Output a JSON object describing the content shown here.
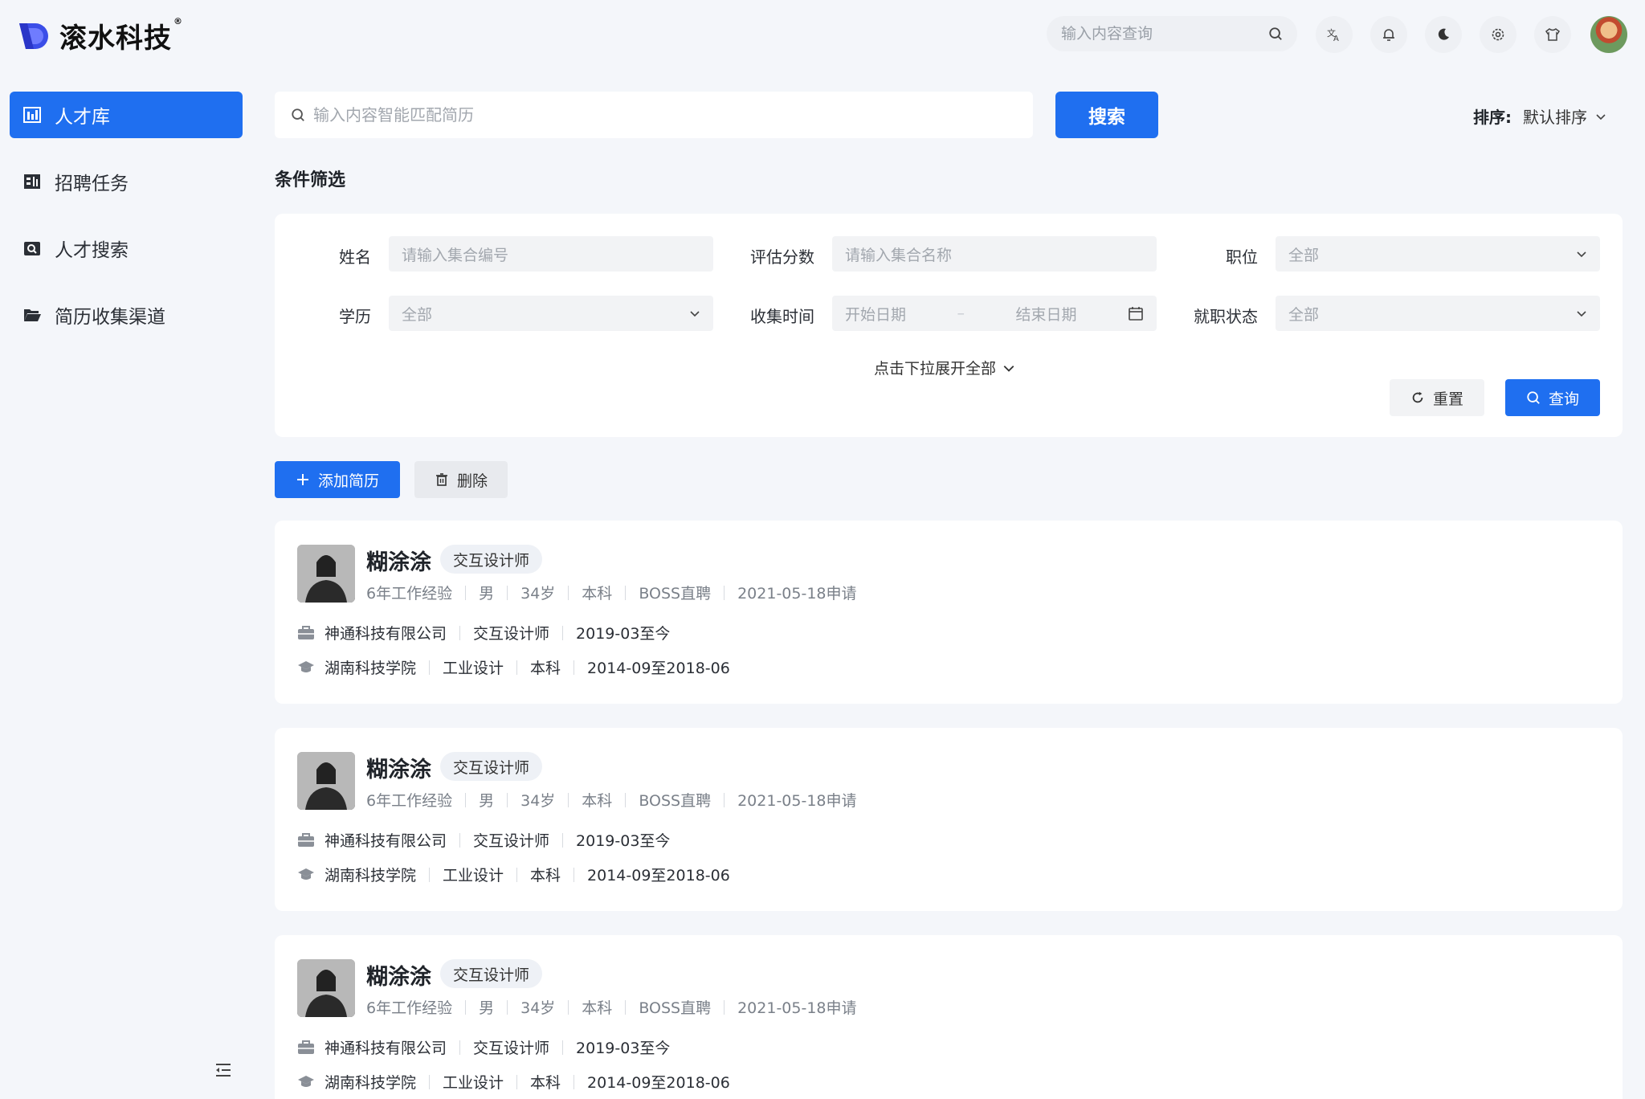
{
  "header": {
    "logo_text": "滚水科技",
    "logo_reg": "®",
    "search_placeholder": "输入内容查询"
  },
  "sidebar": {
    "items": [
      {
        "label": "人才库",
        "icon": "bar-chart-icon",
        "active": true
      },
      {
        "label": "招聘任务",
        "icon": "task-board-icon",
        "active": false
      },
      {
        "label": "人才搜索",
        "icon": "search-folder-icon",
        "active": false
      },
      {
        "label": "简历收集渠道",
        "icon": "folder-open-icon",
        "active": false
      }
    ]
  },
  "main_search": {
    "placeholder": "输入内容智能匹配简历",
    "button": "搜索"
  },
  "sort": {
    "label": "排序:",
    "value": "默认排序"
  },
  "filter": {
    "title": "条件筛选",
    "name_label": "姓名",
    "name_placeholder": "请输入集合编号",
    "score_label": "评估分数",
    "score_placeholder": "请输入集合名称",
    "position_label": "职位",
    "position_value": "全部",
    "edu_label": "学历",
    "edu_value": "全部",
    "collect_label": "收集时间",
    "start_placeholder": "开始日期",
    "date_sep": "–",
    "end_placeholder": "结束日期",
    "status_label": "就职状态",
    "status_value": "全部",
    "expand": "点击下拉展开全部",
    "reset": "重置",
    "query": "查询"
  },
  "actions": {
    "add": "添加简历",
    "delete": "删除"
  },
  "cards": [
    {
      "name": "糊涂涂",
      "tag": "交互设计师",
      "meta": [
        "6年工作经验",
        "男",
        "34岁",
        "本科",
        "BOSS直聘",
        "2021-05-18申请"
      ],
      "work": [
        "神通科技有限公司",
        "交互设计师",
        "2019-03至今"
      ],
      "school": [
        "湖南科技学院",
        "工业设计",
        "本科",
        "2014-09至2018-06"
      ]
    },
    {
      "name": "糊涂涂",
      "tag": "交互设计师",
      "meta": [
        "6年工作经验",
        "男",
        "34岁",
        "本科",
        "BOSS直聘",
        "2021-05-18申请"
      ],
      "work": [
        "神通科技有限公司",
        "交互设计师",
        "2019-03至今"
      ],
      "school": [
        "湖南科技学院",
        "工业设计",
        "本科",
        "2014-09至2018-06"
      ]
    },
    {
      "name": "糊涂涂",
      "tag": "交互设计师",
      "meta": [
        "6年工作经验",
        "男",
        "34岁",
        "本科",
        "BOSS直聘",
        "2021-05-18申请"
      ],
      "work": [
        "神通科技有限公司",
        "交互设计师",
        "2019-03至今"
      ],
      "school": [
        "湖南科技学院",
        "工业设计",
        "本科",
        "2014-09至2018-06"
      ]
    }
  ]
}
